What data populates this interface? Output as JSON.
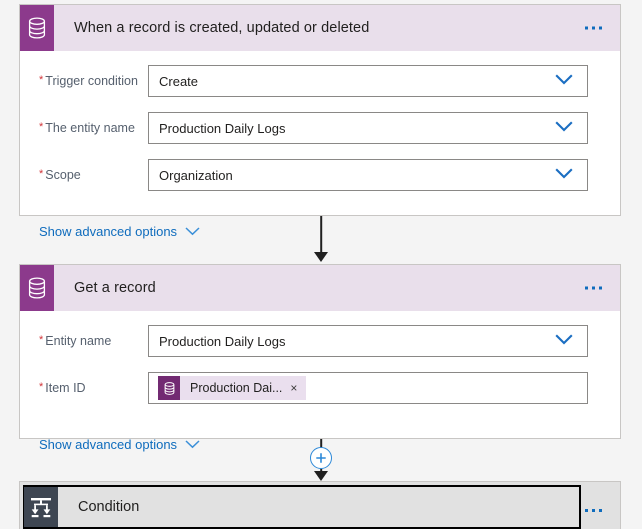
{
  "flow": {
    "steps": [
      {
        "id": "trigger",
        "icon": "database-icon",
        "title": "When a record is created, updated or deleted",
        "menu_label": "More commands",
        "params": [
          {
            "label": "Trigger condition",
            "required": true,
            "value": "Create",
            "control": "dropdown"
          },
          {
            "label": "The entity name",
            "required": true,
            "value": "Production Daily Logs",
            "control": "dropdown"
          },
          {
            "label": "Scope",
            "required": true,
            "value": "Organization",
            "control": "dropdown"
          }
        ],
        "advanced_link": "Show advanced options"
      },
      {
        "id": "get-a-record",
        "icon": "database-icon",
        "title": "Get a record",
        "menu_label": "More commands",
        "params": [
          {
            "label": "Entity name",
            "required": true,
            "value": "Production Daily Logs",
            "control": "dropdown"
          },
          {
            "label": "Item ID",
            "required": true,
            "value": "",
            "control": "token",
            "token": {
              "text": "Production Dai...",
              "icon": "database-icon",
              "remove_label": "×"
            }
          }
        ],
        "advanced_link": "Show advanced options"
      },
      {
        "id": "condition",
        "icon": "condition-branch-icon",
        "title": "Condition",
        "menu_label": "More commands",
        "selected": true
      }
    ],
    "connectors": [
      {
        "id": "trigger-to-get-a-record",
        "has_plus": false
      },
      {
        "id": "get-a-record-to-condition",
        "has_plus": true,
        "plus_label": "Insert a new step"
      }
    ]
  },
  "colors": {
    "canvas_background": "#f4f4f4",
    "card_background": "#ffffff",
    "card_border": "#c8c6c4",
    "header_purple_light": "#e9dfeb",
    "icon_purple": "#8c3a8c",
    "token_purple": "#722a72",
    "token_background": "#eadfee",
    "accent_blue": "#0f6cbd",
    "plus_blue": "#2b88d8",
    "required_red": "#d13438",
    "label_gray": "#56606e",
    "condition_slate": "#3e4652",
    "condition_background": "#e1e1e1",
    "connector_black": "#202020"
  }
}
